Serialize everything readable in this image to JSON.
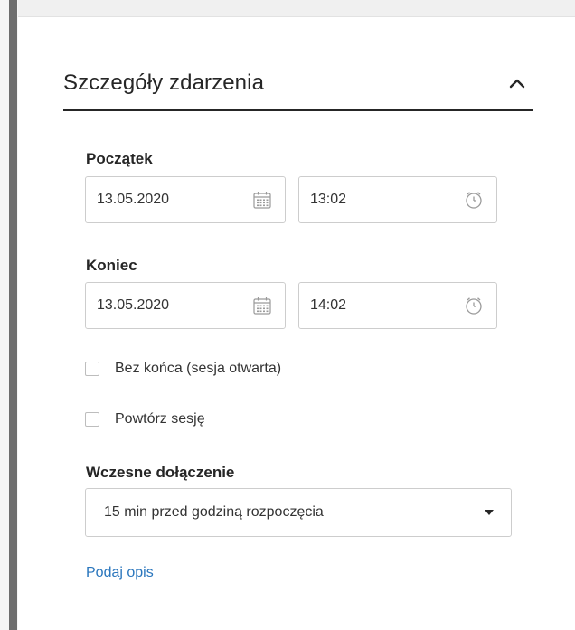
{
  "section": {
    "title": "Szczegóły zdarzenia"
  },
  "start": {
    "label": "Początek",
    "date": "13.05.2020",
    "time": "13:02"
  },
  "end": {
    "label": "Koniec",
    "date": "13.05.2020",
    "time": "14:02"
  },
  "options": {
    "no_end_label": "Bez końca (sesja otwarta)",
    "no_end_checked": false,
    "repeat_label": "Powtórz sesję",
    "repeat_checked": false
  },
  "early_join": {
    "label": "Wczesne dołączenie",
    "selected": "15 min przed godziną rozpoczęcia"
  },
  "description_link": "Podaj opis",
  "icons": {
    "collapse": "chevron-up-icon",
    "date": "calendar-icon",
    "time": "clock-icon",
    "select": "caret-down-icon"
  },
  "colors": {
    "link": "#2a76bd",
    "rule": "#262626",
    "left_bar": "#6e6e6e",
    "field_border": "#cdcdcd"
  }
}
